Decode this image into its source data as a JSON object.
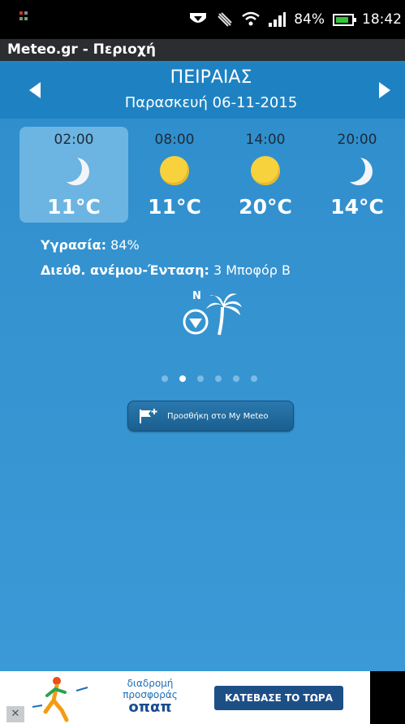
{
  "status_bar": {
    "battery": "84%",
    "time": "18:42"
  },
  "app": {
    "title": "Meteo.gr - Περιοχή"
  },
  "location": {
    "city": "ΠΕΙΡΑΙΑΣ",
    "date": "Παρασκευή 06-11-2015"
  },
  "forecast": [
    {
      "time": "02:00",
      "icon": "moon-icon",
      "temp": "11°C",
      "selected": true
    },
    {
      "time": "08:00",
      "icon": "sun-icon",
      "temp": "11°C",
      "selected": false
    },
    {
      "time": "14:00",
      "icon": "sun-icon",
      "temp": "20°C",
      "selected": false
    },
    {
      "time": "20:00",
      "icon": "moon-icon",
      "temp": "14°C",
      "selected": false
    }
  ],
  "details": {
    "humidity_label": "Υγρασία:",
    "humidity_value": "84%",
    "wind_label": "Διεύθ. ανέμου-Ένταση:",
    "wind_value": "3 Μποφόρ Β",
    "compass_letter": "N"
  },
  "pager": {
    "count": 6,
    "active_index": 1
  },
  "add_button": {
    "label": "Προσθήκη στο My Meteo"
  },
  "ad": {
    "line1": "διαδρομή",
    "line2": "προσφοράς",
    "brand": "οπαπ",
    "cta": "ΚΑΤΕΒΑΣΕ ΤΟ ΤΩΡΑ",
    "close": "✕"
  },
  "colors": {
    "primary_blue": "#2e8dcc",
    "header_blue": "#1e82c2",
    "sun_yellow": "#f8d23c"
  }
}
